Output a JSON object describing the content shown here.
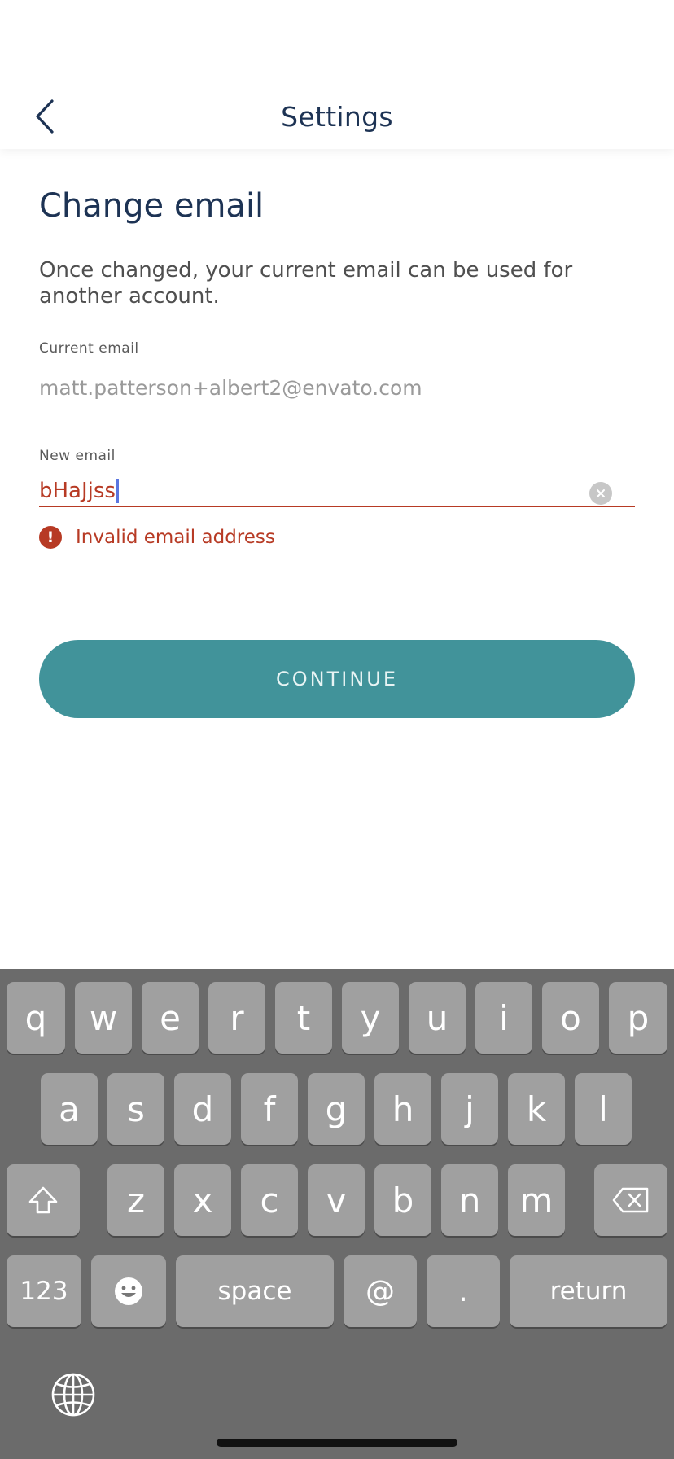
{
  "header": {
    "title": "Settings",
    "back_icon": "chevron-left-icon"
  },
  "page": {
    "title": "Change email",
    "description": "Once changed, your current email can be used for another account."
  },
  "current_email": {
    "label": "Current email",
    "value": "matt.patterson+albert2@envato.com"
  },
  "new_email": {
    "label": "New email",
    "value": "bHaJjss",
    "error": "Invalid email address"
  },
  "continue_label": "CONTINUE",
  "colors": {
    "accent": "#41939a",
    "error": "#b73a24",
    "title": "#1d3354"
  },
  "keyboard": {
    "row1": [
      "q",
      "w",
      "e",
      "r",
      "t",
      "y",
      "u",
      "i",
      "o",
      "p"
    ],
    "row2": [
      "a",
      "s",
      "d",
      "f",
      "g",
      "h",
      "j",
      "k",
      "l"
    ],
    "row3": [
      "z",
      "x",
      "c",
      "v",
      "b",
      "n",
      "m"
    ],
    "numbers": "123",
    "space": "space",
    "at": "@",
    "dot": ".",
    "return": "return"
  }
}
